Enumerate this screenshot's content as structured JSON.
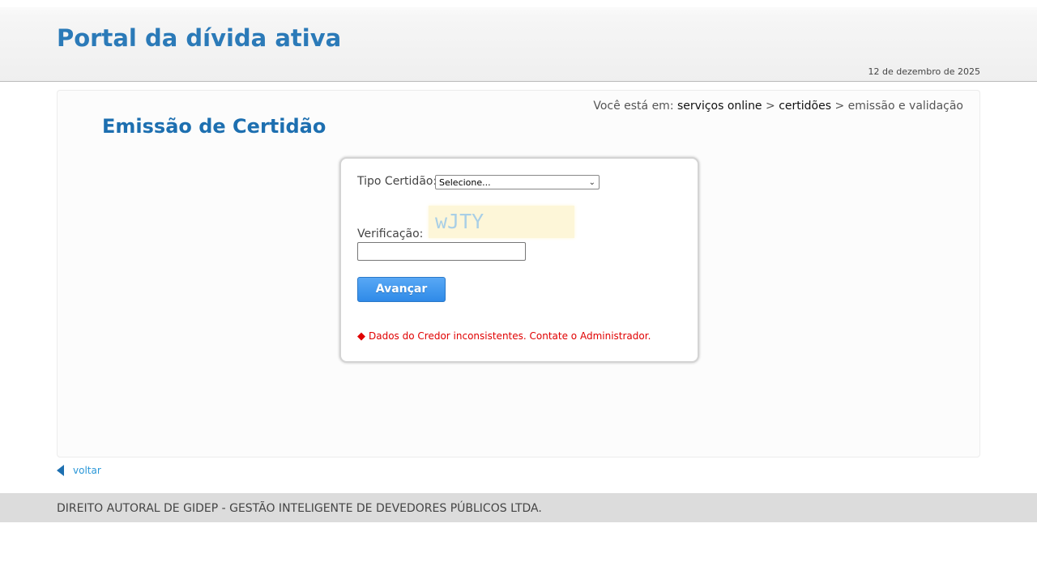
{
  "header": {
    "title": "Portal da dívida ativa",
    "date": "12 de dezembro de 2025"
  },
  "breadcrumb": {
    "prefix": "Você está em:",
    "items": [
      "serviços online",
      "certidões",
      "emissão e validação"
    ],
    "separator": ">"
  },
  "page": {
    "title": "Emissão de Certidão"
  },
  "form": {
    "tipo_label": "Tipo Certidão:",
    "tipo_selected": "Selecione...",
    "verificacao_label": "Verificação:",
    "verificacao_value": "",
    "captcha_text": "wJTY",
    "submit_label": "Avançar",
    "error_message": "Dados do Credor inconsistentes. Contate o Administrador."
  },
  "nav": {
    "back_label": "voltar"
  },
  "footer": {
    "text": "DIREITO AUTORAL DE GIDEP - GESTÃO INTELIGENTE DE DEVEDORES PÚBLICOS LTDA."
  },
  "colors": {
    "title_blue": "#2b7ab8",
    "heading_blue": "#1d6fb0",
    "button_blue": "#3f96ee",
    "error_red": "#e00000",
    "captcha_bg": "#fdf6d8",
    "captcha_text": "#a9cfe6",
    "footer_bg": "#dcdcdc"
  }
}
